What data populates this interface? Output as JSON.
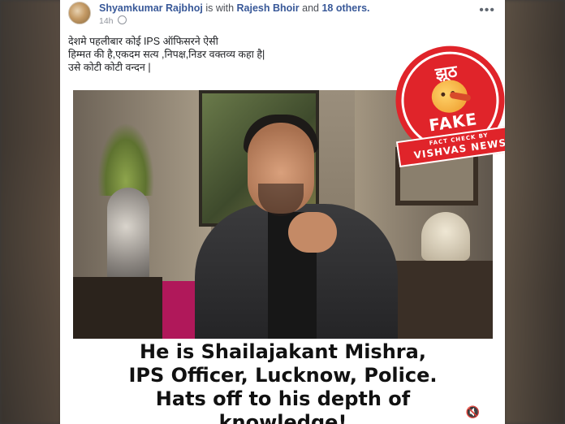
{
  "post": {
    "author": "Shyamkumar Rajbhoj",
    "with_text": "is with",
    "tagged": "Rajesh Bhoir",
    "and_text": "and",
    "others": "18 others.",
    "time": "14h",
    "more_label": "•••",
    "text_lines": [
      "देशमे पहलीबार कोई IPS ऑफिसरने ऐसी",
      "हिम्मत की है,एकदम सत्य ,निपक्ष,निडर  वक्तव्य कहा है|",
      "उसे कोटी कोटी वन्दन |"
    ]
  },
  "media": {
    "caption_lines": [
      "He is Shailajakant Mishra,",
      "IPS Officer, Lucknow, Police.",
      "Hats off to his depth of",
      "knowledge!"
    ],
    "speaker_icon": "speaker-mute-icon",
    "speaker_glyph": "🔇"
  },
  "stamp": {
    "top_text": "झूठ",
    "verdict": "FAKE",
    "ribbon_small": "FACT CHECK BY",
    "ribbon_big": "VISHVAS NEWS",
    "color": "#e0242a"
  }
}
